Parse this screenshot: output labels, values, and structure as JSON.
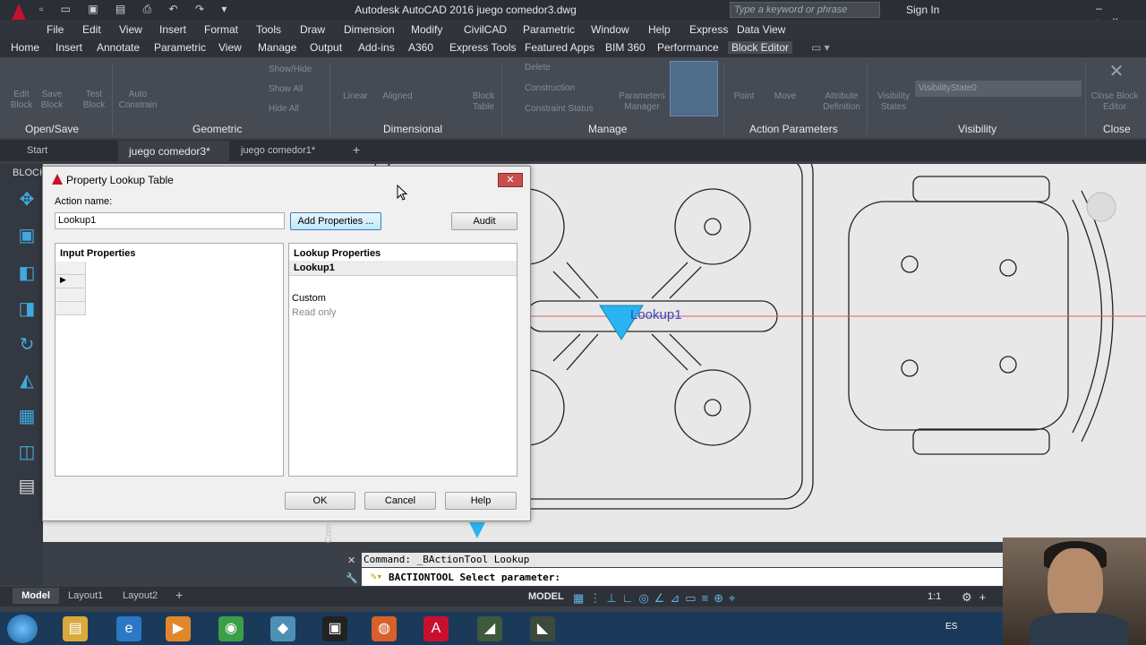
{
  "window": {
    "title": "Autodesk AutoCAD 2016   juego comedor3.dwg",
    "search_placeholder": "Type a keyword or phrase",
    "signin": "Sign In"
  },
  "menu": [
    "File",
    "Edit",
    "View",
    "Insert",
    "Format",
    "Tools",
    "Draw",
    "Dimension",
    "Modify",
    "CivilCAD",
    "Parametric",
    "Window",
    "Help",
    "Express",
    "Data View"
  ],
  "ribbon_tabs": [
    "Home",
    "Insert",
    "Annotate",
    "Parametric",
    "View",
    "Manage",
    "Output",
    "Add-ins",
    "A360",
    "Express Tools",
    "Featured Apps",
    "BIM 360",
    "Performance",
    "Block Editor"
  ],
  "ribbon_panels": {
    "open_save": "Open/Save",
    "geometric": "Geometric",
    "dimensional": "Dimensional",
    "manage": "Manage",
    "action_parameters": "Action Parameters",
    "visibility": "Visibility",
    "close": "Close"
  },
  "ribbon_buttons": {
    "edit_block": "Edit Block",
    "save_block": "Save Block",
    "test_block": "Test Block",
    "auto_constrain": "Auto Constrain",
    "show_hide": "Show/Hide",
    "show_all": "Show All",
    "hide_all": "Hide All",
    "linear": "Linear",
    "aligned": "Aligned",
    "block_table": "Block Table",
    "delete": "Delete",
    "construction": "Construction",
    "constraint_status": "Constraint Status",
    "parameters_manager": "Parameters Manager",
    "point": "Point",
    "move": "Move",
    "attribute_definition": "Attribute Definition",
    "visibility_states": "Visibility States",
    "visibility_state": "VisibilityState0",
    "close_block_editor": "Close Block Editor"
  },
  "file_tabs": [
    "Start",
    "juego comedor3*",
    "juego comedor1*"
  ],
  "palette_label": "BLOCK",
  "canvas": {
    "lookup_label": "Lookup1"
  },
  "dialog": {
    "title": "Property Lookup Table",
    "action_name_label": "Action name:",
    "action_name_value": "Lookup1",
    "add_properties": "Add Properties ...",
    "audit": "Audit",
    "input_properties": "Input Properties",
    "lookup_properties": "Lookup Properties",
    "lookup_column": "Lookup1",
    "custom": "Custom",
    "read_only": "Read only",
    "ok": "OK",
    "cancel": "Cancel",
    "help": "Help"
  },
  "command": {
    "history": "Command: _BActionTool Lookup",
    "prompt": "BACTIONTOOL Select parameter:",
    "vertical_label": "Com"
  },
  "layout_tabs": [
    "Model",
    "Layout1",
    "Layout2"
  ],
  "status": {
    "model": "MODEL",
    "scale": "1:1"
  },
  "taskbar": {
    "language": "ES"
  }
}
